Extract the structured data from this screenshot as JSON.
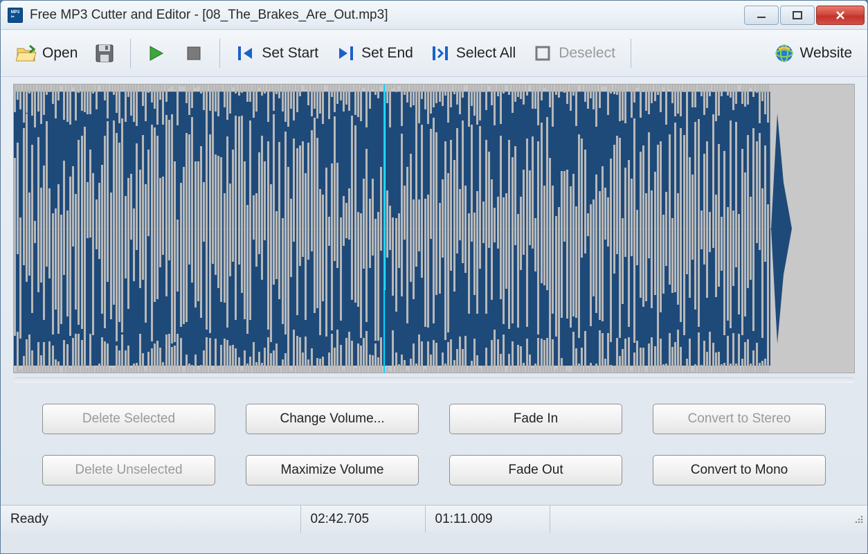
{
  "window": {
    "title": "Free MP3 Cutter and Editor - [08_The_Brakes_Are_Out.mp3]"
  },
  "toolbar": {
    "open": "Open",
    "set_start": "Set Start",
    "set_end": "Set End",
    "select_all": "Select All",
    "deselect": "Deselect",
    "website": "Website"
  },
  "buttons": {
    "delete_selected": "Delete Selected",
    "delete_unselected": "Delete Unselected",
    "change_volume": "Change Volume...",
    "maximize_volume": "Maximize Volume",
    "fade_in": "Fade In",
    "fade_out": "Fade Out",
    "convert_stereo": "Convert to Stereo",
    "convert_mono": "Convert to Mono"
  },
  "status": {
    "state": "Ready",
    "time_total": "02:42.705",
    "time_current": "01:11.009"
  },
  "waveform": {
    "playhead_percent": 44,
    "dense_until_percent": 90,
    "channels": 2
  }
}
